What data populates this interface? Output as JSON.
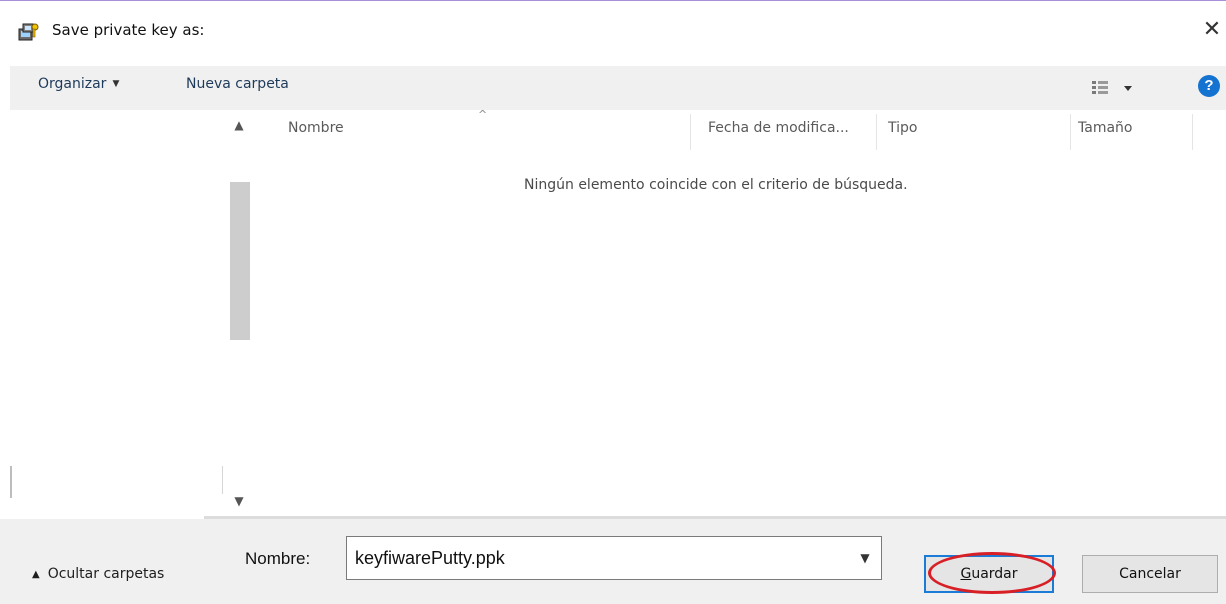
{
  "window": {
    "title": "Save private key as:",
    "close_glyph": "✕",
    "icon": "putty-key-icon"
  },
  "toolbar": {
    "organize_label": "Organizar",
    "new_folder_label": "Nueva carpeta",
    "view_icon": "details-view-icon",
    "help_glyph": "?"
  },
  "file_list": {
    "columns": [
      "Nombre",
      "Fecha de modifica...",
      "Tipo",
      "Tamaño"
    ],
    "empty_message": "Ningún elemento coincide con el criterio de búsqueda."
  },
  "bottom": {
    "hide_folders_label": "Ocultar carpetas",
    "filename_label": "Nombre:",
    "filename_value": "keyfiwarePutty.ppk",
    "save_label_first": "G",
    "save_label_rest": "uardar",
    "cancel_label": "Cancelar"
  },
  "colors": {
    "highlight": "#d81f26",
    "focus_border": "#1a7cd6",
    "help": "#1473d0"
  }
}
